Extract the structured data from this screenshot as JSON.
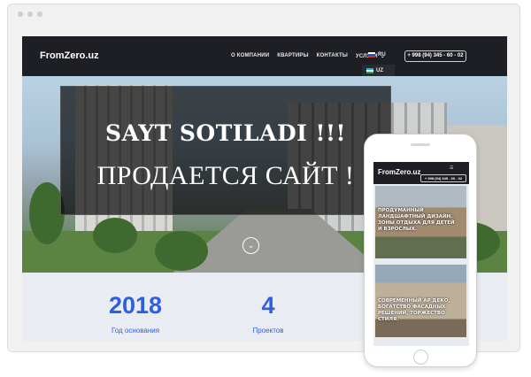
{
  "site": {
    "logo": "FromZero.uz",
    "menu": [
      {
        "label": "О КОМПАНИИ"
      },
      {
        "label": "КВАРТИРЫ"
      },
      {
        "label": "КОНТАКТЫ"
      },
      {
        "label": "УСЛУГИ"
      }
    ],
    "lang_current": "RU",
    "lang_option": "UZ",
    "phone": "+ 998 (94) 345 - 60 - 02"
  },
  "hero": {
    "heading_uz": "SAYT SOTILADI !!!",
    "heading_ru": "ПРОДАЕТСЯ САЙТ !",
    "scroll_icon": "chevron-down-icon"
  },
  "stats": [
    {
      "value": "2018",
      "label": "Год основания"
    },
    {
      "value": "4",
      "label": "Проектов"
    }
  ],
  "mobile": {
    "logo": "FromZero.uz",
    "phone": "+ 998 (94) 345 - 60 - 02",
    "menu_icon": "hamburger-icon",
    "cards": [
      {
        "text": "ПРОДУМАННЫЙ ЛАНДШАФТНЫЙ ДИЗАЙН. ЗОНЫ ОТДЫХА ДЛЯ ДЕТЕЙ И ВЗРОСЛЫХ."
      },
      {
        "text": "СОВРЕМЕННЫЙ АР ДЕКО, БОГАТСТВО ФАСАДНЫХ РЕШЕНИЙ, ТОРЖЕСТВО СТИЛЯ."
      }
    ]
  },
  "colors": {
    "nav_bg": "#1e1f24",
    "accent_blue": "#2f5fe0",
    "stats_bg": "#e9ecf2"
  }
}
